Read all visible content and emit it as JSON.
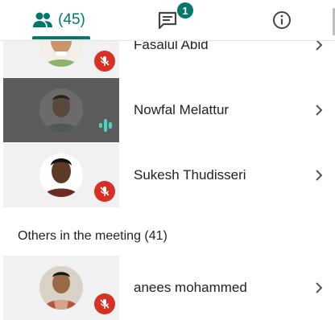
{
  "tabs": {
    "people_count": "(45)",
    "chat_badge": "1"
  },
  "participants": [
    {
      "name": "Fasalul Abid",
      "mic": "off"
    },
    {
      "name": "Nowfal Melattur",
      "mic": "speaking"
    },
    {
      "name": "Sukesh Thudisseri",
      "mic": "off"
    }
  ],
  "others_header": "Others in the meeting (41)",
  "others": [
    {
      "name": "anees mohammed",
      "mic": "off"
    }
  ],
  "colors": {
    "accent": "#00796b",
    "mic_off": "#d93025",
    "speaking": "#4fd1c5"
  },
  "icons": [
    "people-icon",
    "chat-icon",
    "info-icon",
    "mic-off-icon",
    "speaking-icon",
    "chevron-right-icon"
  ]
}
